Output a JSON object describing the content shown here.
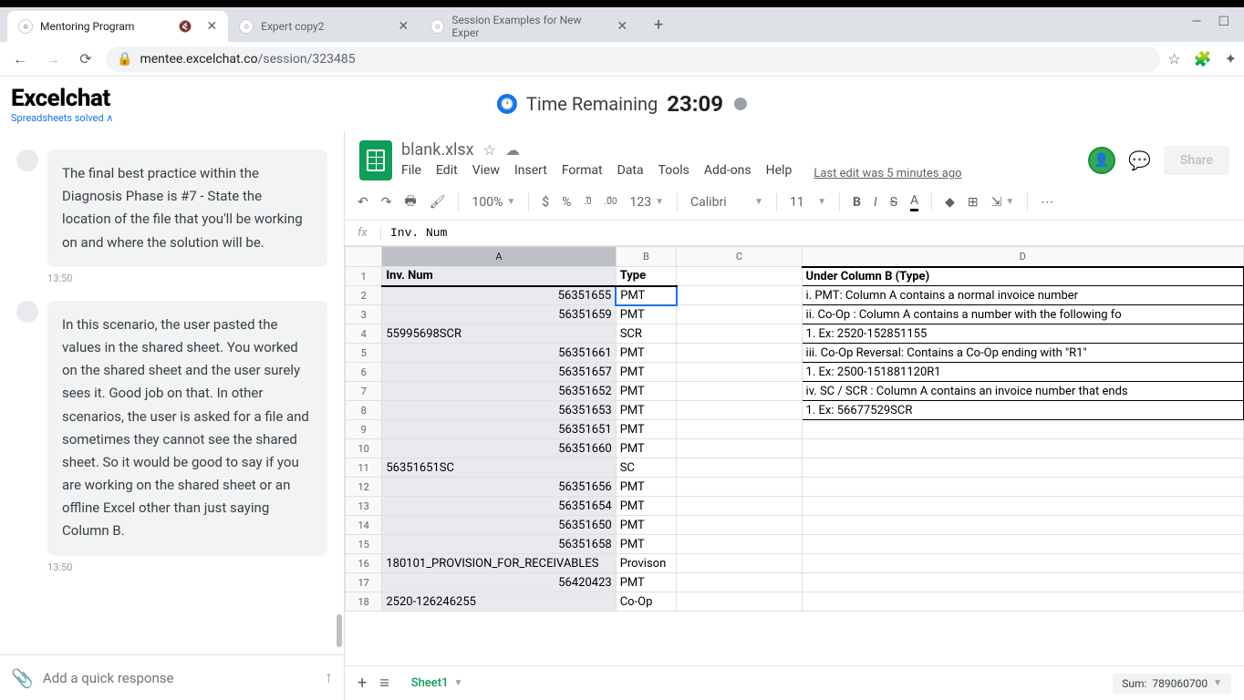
{
  "browser": {
    "tabs": [
      {
        "title": "Mentoring Program",
        "active": true
      },
      {
        "title": "Expert copy2",
        "active": false
      },
      {
        "title": "Session Examples for New Exper",
        "active": false
      }
    ],
    "url_domain": "mentee.excelchat.co",
    "url_path": "/session/323485",
    "window": {
      "min": "—",
      "max": "☐",
      "close": "✕"
    }
  },
  "app": {
    "brand": "Excelchat",
    "tagline": "Spreadsheets solved ∧",
    "timer_label": "Time Remaining",
    "timer_value": "23:09"
  },
  "chat": {
    "messages": [
      {
        "text": "The final best practice within the Diagnosis Phase is #7 - State the location of the file that you'll be working on and where the solution will be.",
        "time": "13:50"
      },
      {
        "text": "In this scenario, the user pasted the values in the shared sheet. You worked on the shared sheet and the user surely sees it. Good job on that. In other scenarios, the user is asked for a file and sometimes they cannot see the shared sheet. So it would be good to say if you are working on the shared sheet or an offline Excel other than just saying Column B.",
        "time": "13:50"
      }
    ],
    "input_placeholder": "Add a quick response"
  },
  "doc": {
    "filename": "blank.xlsx",
    "menus": [
      "File",
      "Edit",
      "View",
      "Insert",
      "Format",
      "Data",
      "Tools",
      "Add-ons",
      "Help"
    ],
    "last_edit": "Last edit was 5 minutes ago",
    "share": "Share"
  },
  "toolbar": {
    "zoom": "100%",
    "currency": "$",
    "percent": "%",
    "dec_dec": ".0",
    "inc_dec": ".00",
    "fmt": "123",
    "font": "Calibri",
    "size": "11"
  },
  "formula": {
    "label": "fx",
    "value": "Inv. Num"
  },
  "grid": {
    "cols": [
      "A",
      "B",
      "C",
      "D"
    ],
    "rows": [
      {
        "n": 1,
        "a": "Inv. Num",
        "b": "Type",
        "d": "Under Column B (Type)",
        "a_align": "left",
        "hdr": true,
        "d_first": true
      },
      {
        "n": 2,
        "a": "56351655",
        "b": "PMT",
        "d": "i.      PMT: Column A contains a normal invoice number",
        "b_active": true
      },
      {
        "n": 3,
        "a": "56351659",
        "b": "PMT",
        "d": "ii.     Co-Op : Column A contains a number with the following fo"
      },
      {
        "n": 4,
        "a": "55995698SCR",
        "b": "SCR",
        "d": "        1.     Ex: 2520-152851155",
        "a_align": "left"
      },
      {
        "n": 5,
        "a": "56351661",
        "b": "PMT",
        "d": "iii.     Co-Op Reversal: Contains a Co-Op ending with \"R1\""
      },
      {
        "n": 6,
        "a": "56351657",
        "b": "PMT",
        "d": "        1.     Ex: 2500-151881120R1"
      },
      {
        "n": 7,
        "a": "56351652",
        "b": "PMT",
        "d": "iv.     SC / SCR : Column A contains an invoice number that ends"
      },
      {
        "n": 8,
        "a": "56351653",
        "b": "PMT",
        "d": "        1.     Ex: 56677529SCR",
        "d_last": true
      },
      {
        "n": 9,
        "a": "56351651",
        "b": "PMT"
      },
      {
        "n": 10,
        "a": "56351660",
        "b": "PMT"
      },
      {
        "n": 11,
        "a": "56351651SC",
        "b": "SC",
        "a_align": "left"
      },
      {
        "n": 12,
        "a": "56351656",
        "b": "PMT"
      },
      {
        "n": 13,
        "a": "56351654",
        "b": "PMT"
      },
      {
        "n": 14,
        "a": "56351650",
        "b": "PMT"
      },
      {
        "n": 15,
        "a": "56351658",
        "b": "PMT"
      },
      {
        "n": 16,
        "a": "180101_PROVISION_FOR_RECEIVABLES",
        "b": "Provison",
        "a_align": "left"
      },
      {
        "n": 17,
        "a": "56420423",
        "b": "PMT"
      },
      {
        "n": 18,
        "a": "2520-126246255",
        "b": "Co-Op",
        "a_align": "left"
      }
    ]
  },
  "footer": {
    "sheet": "Sheet1",
    "sum_label": "Sum:",
    "sum_value": "789060700"
  }
}
